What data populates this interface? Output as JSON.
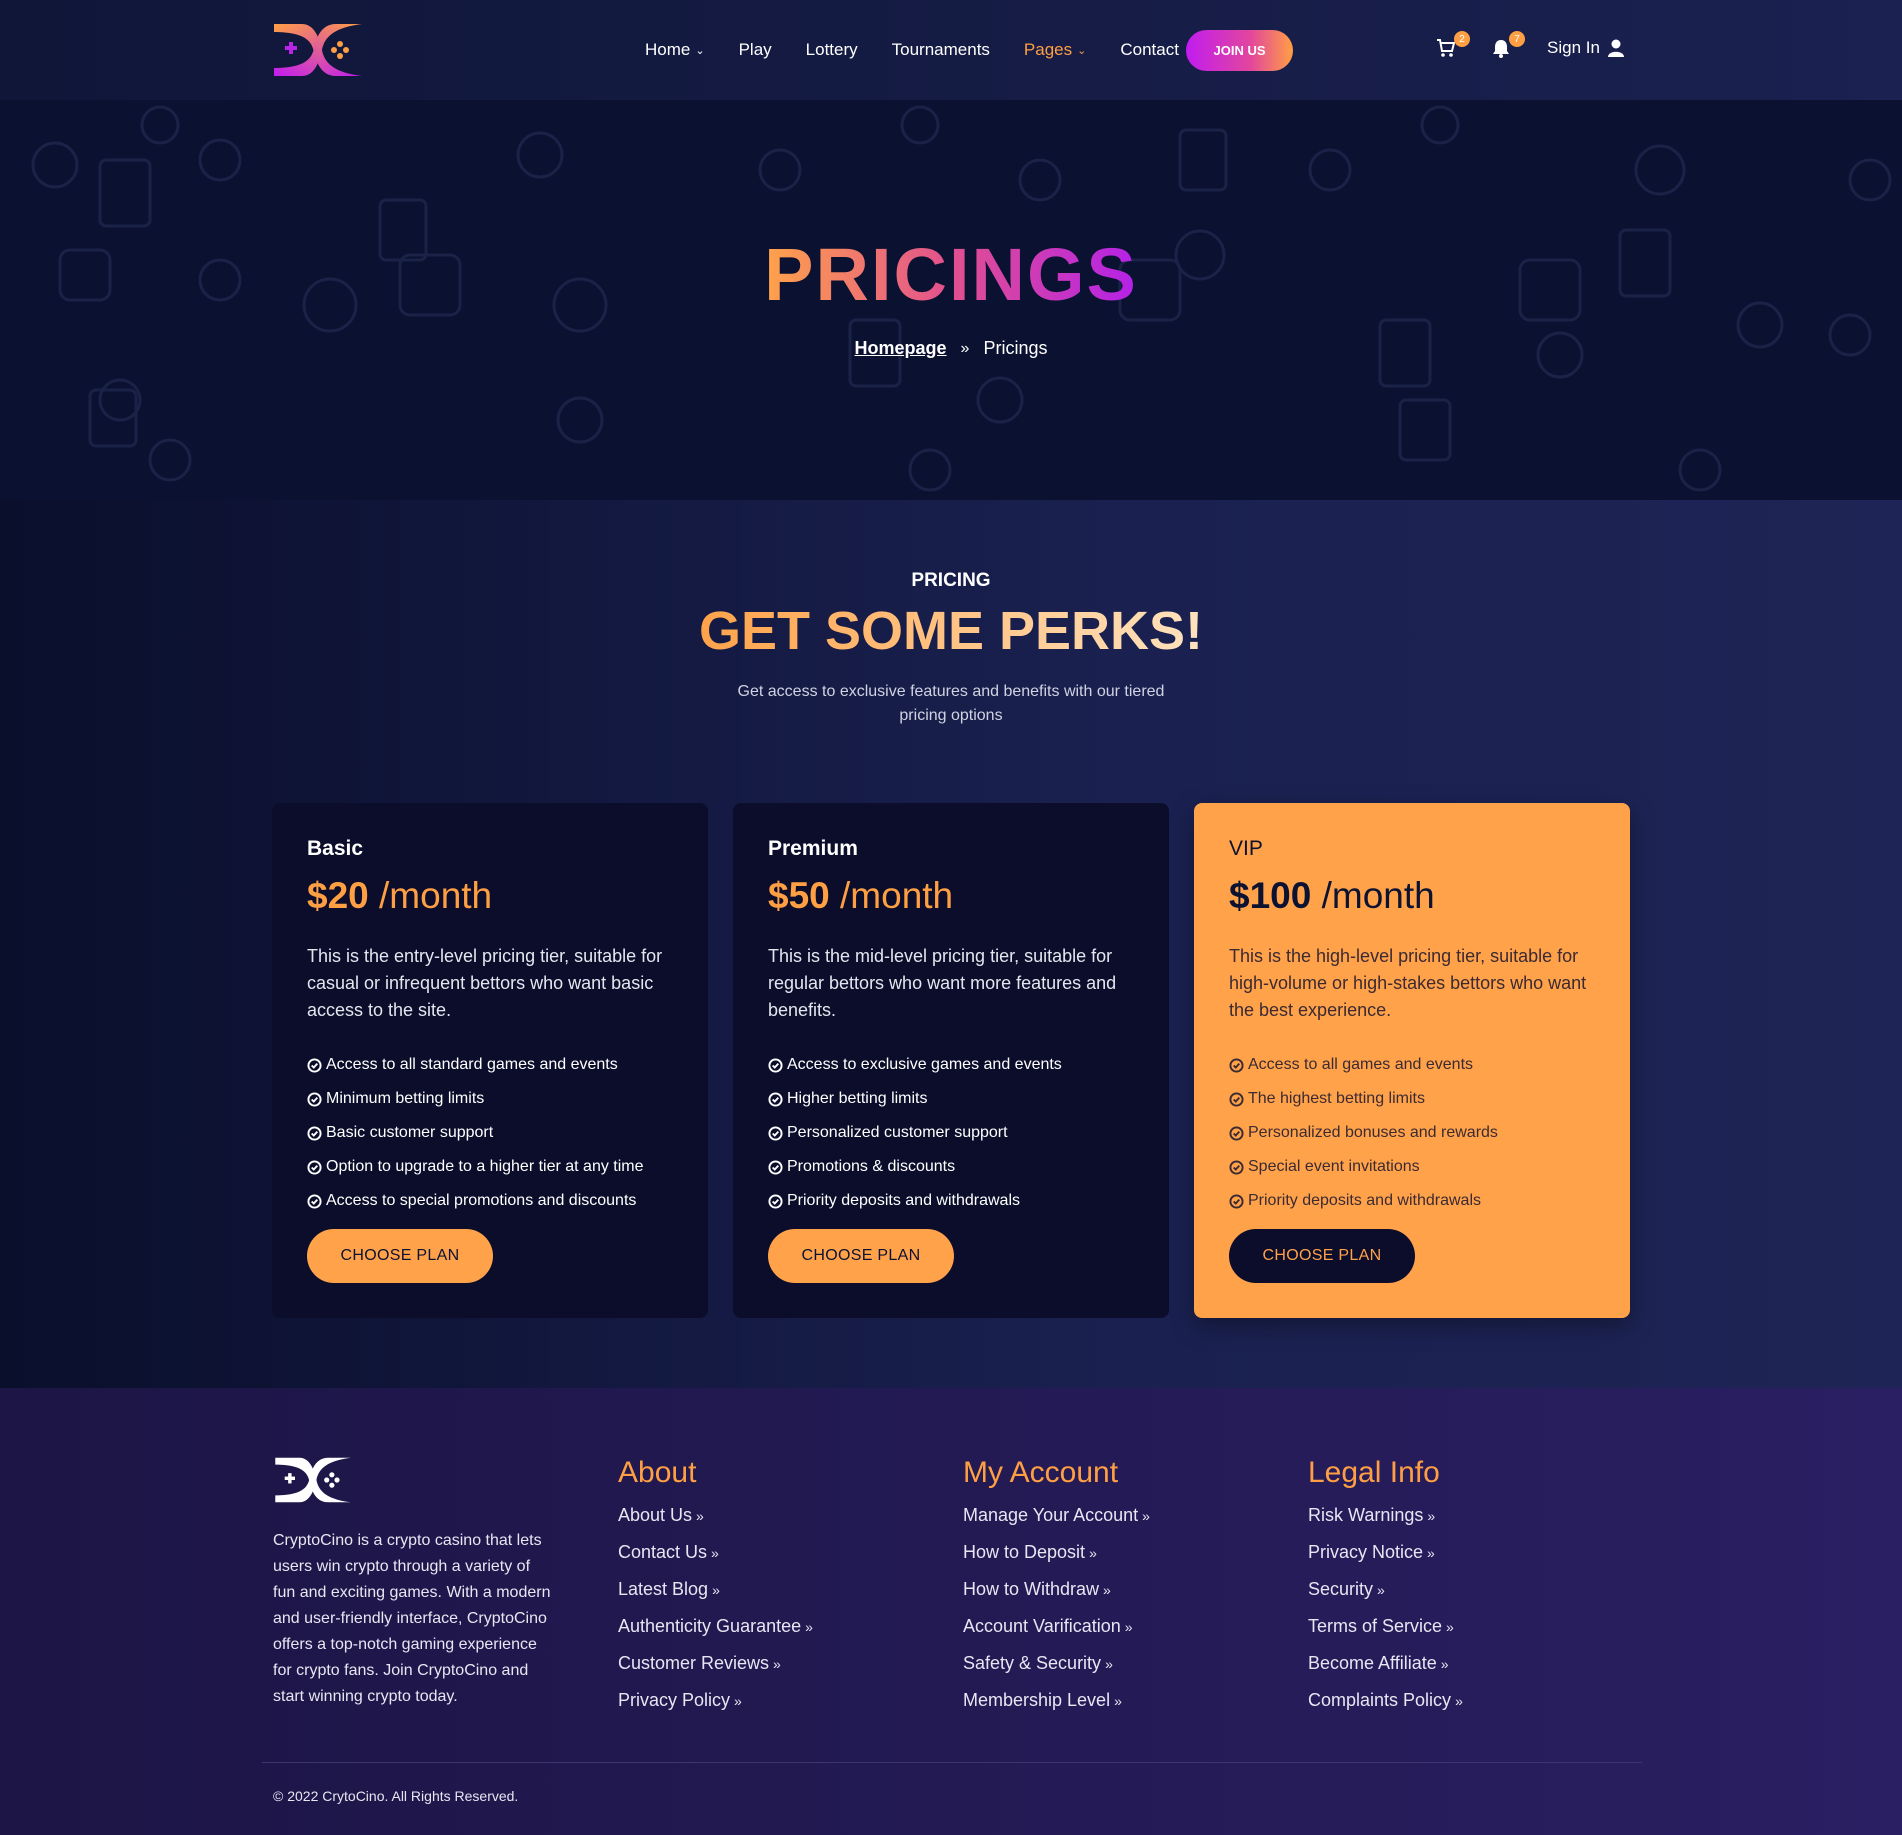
{
  "nav": {
    "items": [
      {
        "label": "Home",
        "dropdown": true,
        "active": false
      },
      {
        "label": "Play",
        "dropdown": false,
        "active": false
      },
      {
        "label": "Lottery",
        "dropdown": false,
        "active": false
      },
      {
        "label": "Tournaments",
        "dropdown": false,
        "active": false
      },
      {
        "label": "Pages",
        "dropdown": true,
        "active": true
      },
      {
        "label": "Contact",
        "dropdown": false,
        "active": false
      }
    ],
    "join_label": "JOIN US",
    "cart_count": "2",
    "notif_count": "7",
    "signin_label": "Sign In"
  },
  "hero": {
    "title": "PRICINGS",
    "breadcrumb_home": "Homepage",
    "breadcrumb_current": "Pricings"
  },
  "pricing": {
    "eyebrow": "PRICING",
    "title": "GET SOME PERKS!",
    "subtitle": "Get access to exclusive features and benefits with our tiered pricing options",
    "plans": [
      {
        "name": "Basic",
        "amount": "$20",
        "period": "/month",
        "description": "This is the entry-level pricing tier, suitable for casual or infrequent bettors who want basic access to the site.",
        "features": [
          "Access to all standard games and events",
          "Minimum betting limits",
          "Basic customer support",
          "Option to upgrade to a higher tier at any time",
          "Access to special promotions and discounts"
        ],
        "button": "CHOOSE PLAN"
      },
      {
        "name": "Premium",
        "amount": "$50",
        "period": "/month",
        "description": "This is the mid-level pricing tier, suitable for regular bettors who want more features and benefits.",
        "features": [
          "Access to exclusive games and events",
          "Higher betting limits",
          "Personalized customer support",
          "Promotions & discounts",
          "Priority deposits and withdrawals"
        ],
        "button": "CHOOSE PLAN"
      },
      {
        "name": "VIP",
        "amount": "$100",
        "period": "/month",
        "description": "This is the high-level pricing tier, suitable for high-volume or high-stakes bettors who want the best experience.",
        "features": [
          "Access to all games and events",
          "The highest betting limits",
          "Personalized bonuses and rewards",
          "Special event invitations",
          "Priority deposits and withdrawals"
        ],
        "button": "CHOOSE PLAN"
      }
    ]
  },
  "footer": {
    "about_text": "CryptoCino is a crypto casino that lets users win crypto through a variety of fun and exciting games. With a modern and user-friendly interface, CryptoCino offers a top-notch gaming experience for crypto fans. Join CryptoCino and start winning crypto today.",
    "columns": [
      {
        "title": "About",
        "links": [
          "About Us",
          "Contact Us",
          "Latest Blog",
          "Authenticity Guarantee",
          "Customer Reviews",
          "Privacy Policy"
        ]
      },
      {
        "title": "My Account",
        "links": [
          "Manage Your Account",
          "How to Deposit",
          "How to Withdraw",
          "Account Varification",
          "Safety & Security",
          "Membership Level"
        ]
      },
      {
        "title": "Legal Info",
        "links": [
          "Risk Warnings",
          "Privacy Notice",
          "Security",
          "Terms of Service",
          "Become Affiliate",
          "Complaints Policy"
        ]
      }
    ],
    "copyright": "© 2022 CrytoCino. All Rights Reserved."
  },
  "colors": {
    "accent_orange": "#ff9f43",
    "accent_purple": "#c11cf0",
    "background_navy": "#0c1231"
  },
  "icons": [
    "logo-icon",
    "chevron-down-icon",
    "cart-icon",
    "bell-icon",
    "user-icon",
    "double-chevron-right-icon",
    "check-circle-icon"
  ]
}
